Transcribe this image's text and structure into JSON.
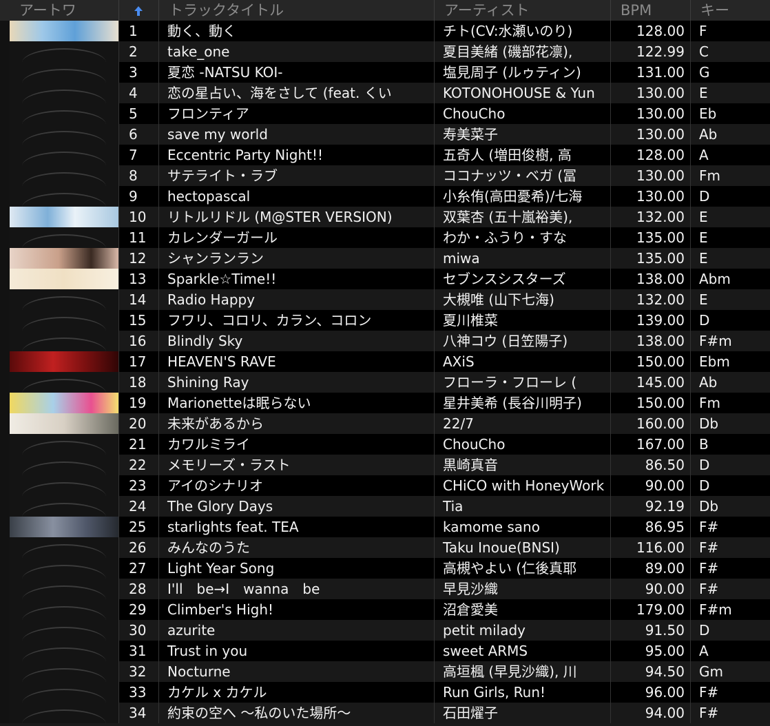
{
  "header": {
    "artwork": "アートワ",
    "title": "トラックタイトル",
    "artist": "アーティスト",
    "bpm": "BPM",
    "key": "キー",
    "sort_icon": "arrow-up-icon",
    "sort_color": "#4a8cf0"
  },
  "tracks": [
    {
      "num": "1",
      "title": "動く、動く",
      "artist": "チト(CV:水瀬いのり)",
      "bpm": "128.00",
      "key": "F",
      "art": "art-1"
    },
    {
      "num": "2",
      "title": "take_one",
      "artist": "夏目美緒 (磯部花凛),",
      "bpm": "122.99",
      "key": "C",
      "art": ""
    },
    {
      "num": "3",
      "title": "夏恋 -NATSU KOI-",
      "artist": "塩見周子 (ルゥティン)",
      "bpm": "131.00",
      "key": "G",
      "art": ""
    },
    {
      "num": "4",
      "title": "恋の星占い、海をさして (feat. くい",
      "artist": "KOTONOHOUSE & Yun",
      "bpm": "130.00",
      "key": "E",
      "art": ""
    },
    {
      "num": "5",
      "title": "フロンティア",
      "artist": "ChouCho",
      "bpm": "130.00",
      "key": "Eb",
      "art": ""
    },
    {
      "num": "6",
      "title": "save my world",
      "artist": "寿美菜子",
      "bpm": "130.00",
      "key": "Ab",
      "art": ""
    },
    {
      "num": "7",
      "title": "Eccentric Party Night!!",
      "artist": "五奇人 (増田俊樹, 高",
      "bpm": "128.00",
      "key": "A",
      "art": ""
    },
    {
      "num": "8",
      "title": "サテライト・ラブ",
      "artist": "ココナッツ・ベガ (冨",
      "bpm": "130.00",
      "key": "Fm",
      "art": ""
    },
    {
      "num": "9",
      "title": "hectopascal",
      "artist": "小糸侑(高田憂希)/七海",
      "bpm": "130.00",
      "key": "D",
      "art": ""
    },
    {
      "num": "10",
      "title": "リトルリドル (M@STER VERSION)",
      "artist": "双葉杏 (五十嵐裕美),",
      "bpm": "132.00",
      "key": "E",
      "art": "art-10"
    },
    {
      "num": "11",
      "title": "カレンダーガール",
      "artist": "わか・ふうり・すな",
      "bpm": "135.00",
      "key": "E",
      "art": ""
    },
    {
      "num": "12",
      "title": "シャンランラン",
      "artist": "miwa",
      "bpm": "135.00",
      "key": "E",
      "art": "art-12"
    },
    {
      "num": "13",
      "title": "Sparkle☆Time!!",
      "artist": "セブンスシスターズ",
      "bpm": "138.00",
      "key": "Abm",
      "art": "art-13"
    },
    {
      "num": "14",
      "title": "Radio Happy",
      "artist": "大槻唯 (山下七海)",
      "bpm": "132.00",
      "key": "E",
      "art": ""
    },
    {
      "num": "15",
      "title": "フワリ、コロリ、カラン、コロン",
      "artist": "夏川椎菜",
      "bpm": "139.00",
      "key": "D",
      "art": ""
    },
    {
      "num": "16",
      "title": "Blindly Sky",
      "artist": "八神コウ (日笠陽子)",
      "bpm": "138.00",
      "key": "F#m",
      "art": ""
    },
    {
      "num": "17",
      "title": "HEAVEN'S RAVE",
      "artist": "AXiS",
      "bpm": "150.00",
      "key": "Ebm",
      "art": "art-17"
    },
    {
      "num": "18",
      "title": "Shining Ray",
      "artist": "フローラ・フローレ (",
      "bpm": "145.00",
      "key": "Ab",
      "art": ""
    },
    {
      "num": "19",
      "title": "Marionetteは眠らない",
      "artist": "星井美希 (長谷川明子)",
      "bpm": "150.00",
      "key": "Fm",
      "art": "art-19"
    },
    {
      "num": "20",
      "title": "未来があるから",
      "artist": "22/7",
      "bpm": "160.00",
      "key": "Db",
      "art": "art-20"
    },
    {
      "num": "21",
      "title": "カワルミライ",
      "artist": "ChouCho",
      "bpm": "167.00",
      "key": "B",
      "art": ""
    },
    {
      "num": "22",
      "title": "メモリーズ・ラスト",
      "artist": "黒崎真音",
      "bpm": "86.50",
      "key": "D",
      "art": ""
    },
    {
      "num": "23",
      "title": "アイのシナリオ",
      "artist": "CHiCO with HoneyWork",
      "bpm": "90.00",
      "key": "D",
      "art": ""
    },
    {
      "num": "24",
      "title": "The Glory Days",
      "artist": "Tia",
      "bpm": "92.19",
      "key": "Db",
      "art": ""
    },
    {
      "num": "25",
      "title": "starlights feat. TEA",
      "artist": "kamome sano",
      "bpm": "86.95",
      "key": "F#",
      "art": "art-25"
    },
    {
      "num": "26",
      "title": "みんなのうた",
      "artist": "Taku Inoue(BNSI)",
      "bpm": "116.00",
      "key": "F#",
      "art": ""
    },
    {
      "num": "27",
      "title": "Light Year Song",
      "artist": "高槻やよい (仁後真耶",
      "bpm": "89.00",
      "key": "F#",
      "art": ""
    },
    {
      "num": "28",
      "title": "I'll　be→I　wanna　be",
      "artist": "早見沙織",
      "bpm": "90.00",
      "key": "F#",
      "art": ""
    },
    {
      "num": "29",
      "title": "Climber's High!",
      "artist": "沼倉愛美",
      "bpm": "179.00",
      "key": "F#m",
      "art": ""
    },
    {
      "num": "30",
      "title": "azurite",
      "artist": "petit milady",
      "bpm": "91.50",
      "key": "D",
      "art": ""
    },
    {
      "num": "31",
      "title": "Trust in you",
      "artist": "sweet ARMS",
      "bpm": "95.00",
      "key": "A",
      "art": ""
    },
    {
      "num": "32",
      "title": "Nocturne",
      "artist": "高垣楓 (早見沙織), 川",
      "bpm": "94.50",
      "key": "Gm",
      "art": ""
    },
    {
      "num": "33",
      "title": "カケル x カケル",
      "artist": "Run Girls, Run!",
      "bpm": "96.00",
      "key": "F#",
      "art": ""
    },
    {
      "num": "34",
      "title": "約束の空へ ～私のいた場所～",
      "artist": "石田燿子",
      "bpm": "94.00",
      "key": "F#",
      "art": ""
    }
  ]
}
